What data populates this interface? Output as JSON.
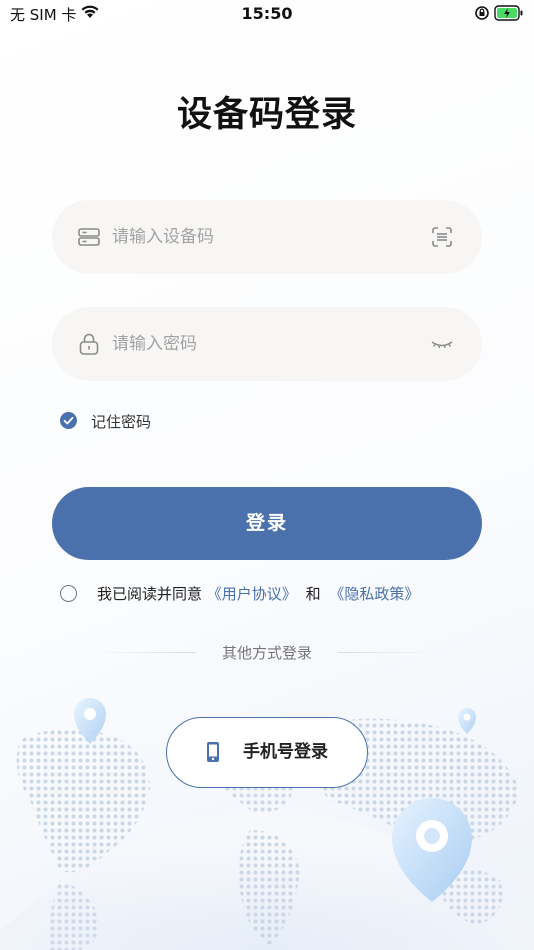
{
  "status_bar": {
    "carrier": "无 SIM 卡",
    "time": "15:50"
  },
  "title": "设备码登录",
  "device_field": {
    "placeholder": "请输入设备码",
    "value": "",
    "lead_icon": "device-icon",
    "trail_icon": "scan-icon"
  },
  "password_field": {
    "placeholder": "请输入密码",
    "value": "",
    "lead_icon": "lock-icon",
    "trail_icon": "eye-closed-icon"
  },
  "remember": {
    "label": "记住密码",
    "checked": true
  },
  "login_button": "登录",
  "agreement": {
    "prefix": "我已阅读并同意",
    "user_agreement": "《用户协议》",
    "and": "和",
    "privacy_policy": "《隐私政策》",
    "checked": false
  },
  "other_methods": {
    "label": "其他方式登录",
    "phone_login": "手机号登录"
  },
  "colors": {
    "accent": "#4b71ad",
    "field_bg": "#f7f6f4"
  }
}
